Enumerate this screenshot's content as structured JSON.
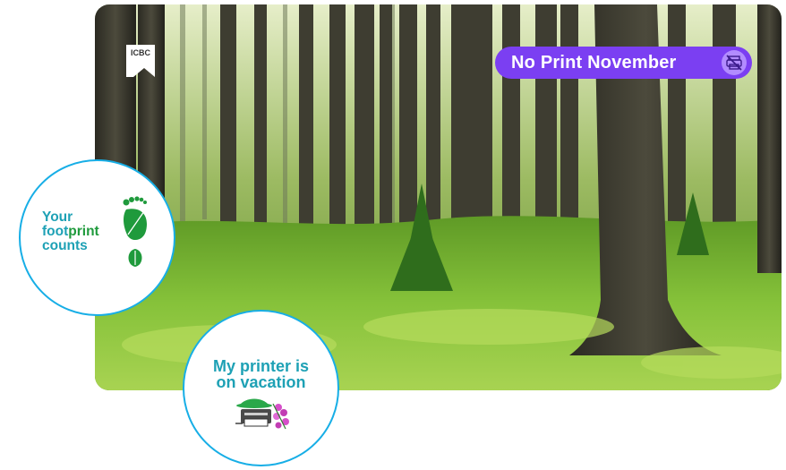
{
  "hero": {
    "description_icon": "forest-photo",
    "logo_text": "ICBC"
  },
  "pill": {
    "label": "No Print November",
    "icon": "no-printer-icon",
    "color": "#7b3ff2"
  },
  "circle_footprint": {
    "line1": "Your",
    "line2_a": "foot",
    "line2_b": "print",
    "line3": "counts",
    "icon": "footprint-leaf-icon"
  },
  "circle_vacation": {
    "line1": "My printer is",
    "line2": "on vacation",
    "icon": "printer-vacation-icon"
  },
  "colors": {
    "accent_blue": "#17aee6",
    "teal_text": "#1ea1b5",
    "green_text": "#1f9a3c"
  }
}
